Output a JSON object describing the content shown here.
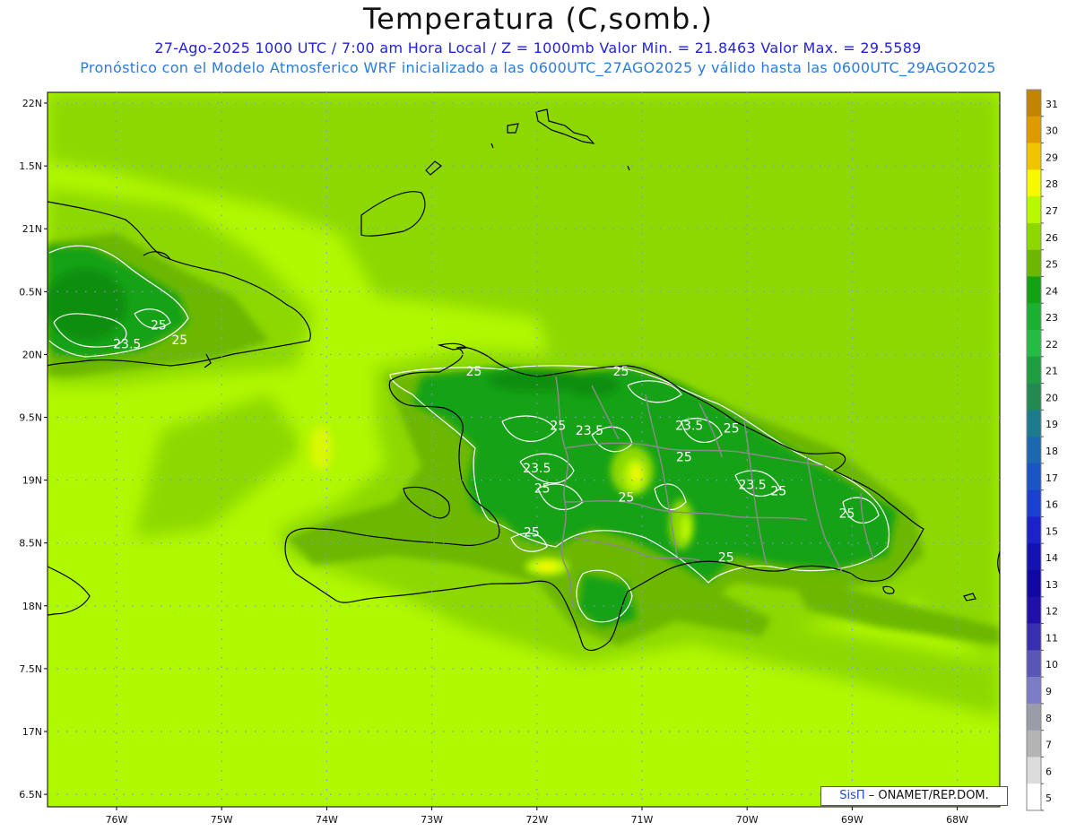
{
  "header": {
    "title": "Temperatura (C,somb.)",
    "line1": "27-Ago-2025  1000 UTC / 7:00 am Hora Local / Z = 1000mb   Valor Min. = 21.8463  Valor Max. = 29.5589",
    "line2": "Pronóstico con el Modelo Atmosferico WRF inicializado a las 0600UTC_27AGO2025 y válido hasta las  0600UTC_29AGO2025"
  },
  "map": {
    "type": "filled-contour",
    "variable": "Temperatura",
    "units": "C",
    "level": "1000mb",
    "lon_ticks": [
      "76W",
      "75W",
      "74W",
      "73W",
      "72W",
      "71W",
      "70W",
      "69W",
      "68W"
    ],
    "lat_ticks": [
      "22N",
      "1.5N",
      "21N",
      "0.5N",
      "20N",
      "9.5N",
      "19N",
      "8.5N",
      "18N",
      "7.5N",
      "17N",
      "6.5N"
    ],
    "lon_values": [
      -76,
      -75,
      -74,
      -73,
      -72,
      -71,
      -70,
      -69,
      -68
    ],
    "lat_values": [
      22,
      21.5,
      21,
      20.5,
      20,
      19.5,
      19,
      18.5,
      18,
      17.5,
      17,
      16.5
    ],
    "contour_labels": [
      {
        "text": "23.5",
        "lon": -75.9,
        "lat": 20.05
      },
      {
        "text": "25",
        "lon": -75.6,
        "lat": 20.2
      },
      {
        "text": "25",
        "lon": -75.4,
        "lat": 20.08
      },
      {
        "text": "25",
        "lon": -72.6,
        "lat": 19.83
      },
      {
        "text": "25",
        "lon": -71.8,
        "lat": 19.4
      },
      {
        "text": "23.5",
        "lon": -71.5,
        "lat": 19.36
      },
      {
        "text": "25",
        "lon": -71.2,
        "lat": 19.83
      },
      {
        "text": "23.5",
        "lon": -70.55,
        "lat": 19.4
      },
      {
        "text": "25",
        "lon": -70.15,
        "lat": 19.38
      },
      {
        "text": "23.5",
        "lon": -72.0,
        "lat": 19.06
      },
      {
        "text": "25",
        "lon": -70.6,
        "lat": 19.15
      },
      {
        "text": "23.5",
        "lon": -69.95,
        "lat": 18.93
      },
      {
        "text": "25",
        "lon": -69.7,
        "lat": 18.88
      },
      {
        "text": "25",
        "lon": -71.95,
        "lat": 18.9
      },
      {
        "text": "25",
        "lon": -71.15,
        "lat": 18.83
      },
      {
        "text": "25",
        "lon": -69.05,
        "lat": 18.7
      },
      {
        "text": "25",
        "lon": -72.05,
        "lat": 18.55
      },
      {
        "text": "25",
        "lon": -70.2,
        "lat": 18.35
      }
    ]
  },
  "colorbar": {
    "labels": [
      "31",
      "30",
      "29",
      "28",
      "27",
      "26",
      "25",
      "24",
      "23",
      "22",
      "21",
      "20",
      "19",
      "18",
      "17",
      "16",
      "15",
      "14",
      "13",
      "12",
      "11",
      "10",
      "9",
      "8",
      "7",
      "6",
      "5"
    ],
    "colors": [
      "#c48400",
      "#e09a00",
      "#f2c400",
      "#f8f800",
      "#b8f800",
      "#8cd800",
      "#6cb800",
      "#12a212",
      "#1ab030",
      "#25bc44",
      "#1e9e40",
      "#228a50",
      "#1c7b8c",
      "#1a68b0",
      "#1a55c6",
      "#1a40d0",
      "#1a22c8",
      "#1412b0",
      "#1008a0",
      "#2010a8",
      "#3830b0",
      "#5a56b8",
      "#7c7cc6",
      "#9c9ca8",
      "#b4b4b4",
      "#dcdcdc",
      "#ffffff"
    ]
  },
  "credit": {
    "brand": "SisΠ",
    "text": " – ONAMET/REP.DOM."
  }
}
